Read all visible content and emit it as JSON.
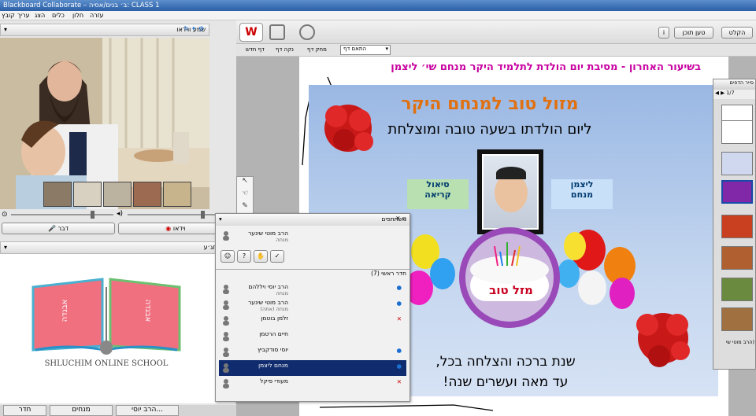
{
  "titlebar": {
    "title": "Blackboard Collaborate – ב׳ בנים/אסיה: CLASS 1"
  },
  "menu": [
    "קובץ",
    "עריך",
    "הצג",
    "כלים",
    "חלון",
    "עזרה"
  ],
  "video_panel": {
    "header": "שמע ווידאו",
    "talk_button": "דבר",
    "video_button": "וידאו"
  },
  "whiteboard_panel": {
    "header": "בניקוחג׳ע"
  },
  "logo": {
    "text": "SHLUCHIM ONLINE SCHOOL",
    "letters": "אבגדה"
  },
  "toolbar": {
    "load_content": "טען תוכן",
    "i_label": "i",
    "record": "הקלט"
  },
  "pagebar": {
    "fit_page": "התאם דף",
    "clear_page": "נקה דף",
    "new_page": "דף חדש",
    "prev_page": "מחק דף"
  },
  "whiteboard": {
    "heading": "בשיעור האחרון - מסיבת יום הולדת לתלמיד היקר מנחם שי׳ ליצמן"
  },
  "slide": {
    "title": "מזול טוב למנחם היקר",
    "subtitle": "ליום הולדתו בשעה טובה ומוצלחת",
    "left_box": [
      "סיאול",
      "קריאה"
    ],
    "right_box": [
      "ליצמן",
      "מנחם"
    ],
    "cake_text": "מזל טוב",
    "footer1": "שנת ברכה והצלחה בכל,",
    "footer2": "עד מאה ועשרים שנה!"
  },
  "participants": {
    "header": "משתתפים",
    "top_user": {
      "name": "הרב מוטי שינער",
      "role": "מנחה"
    },
    "room": "חדר ראשי (7)",
    "list": [
      {
        "name": "הרב יוסי ויללהם",
        "role": "מנחה"
      },
      {
        "name": "הרב מוטי שינער",
        "role": "מנחה (אתה)"
      },
      {
        "name": "זלמן בוטמן",
        "role": ""
      },
      {
        "name": "חיים הרטמן",
        "role": ""
      },
      {
        "name": "יוסי סודקביץ",
        "role": ""
      },
      {
        "name": "מנחם ליצמן",
        "role": ""
      },
      {
        "name": "מעודי פיקל",
        "role": ""
      }
    ]
  },
  "sorter": {
    "header": "סייר הדפים",
    "page_label": "1/7",
    "footer": "(הרב מוטי שי"
  },
  "bottom_tabs": [
    "חדר",
    "מנחים",
    "הרב יוסי..."
  ]
}
